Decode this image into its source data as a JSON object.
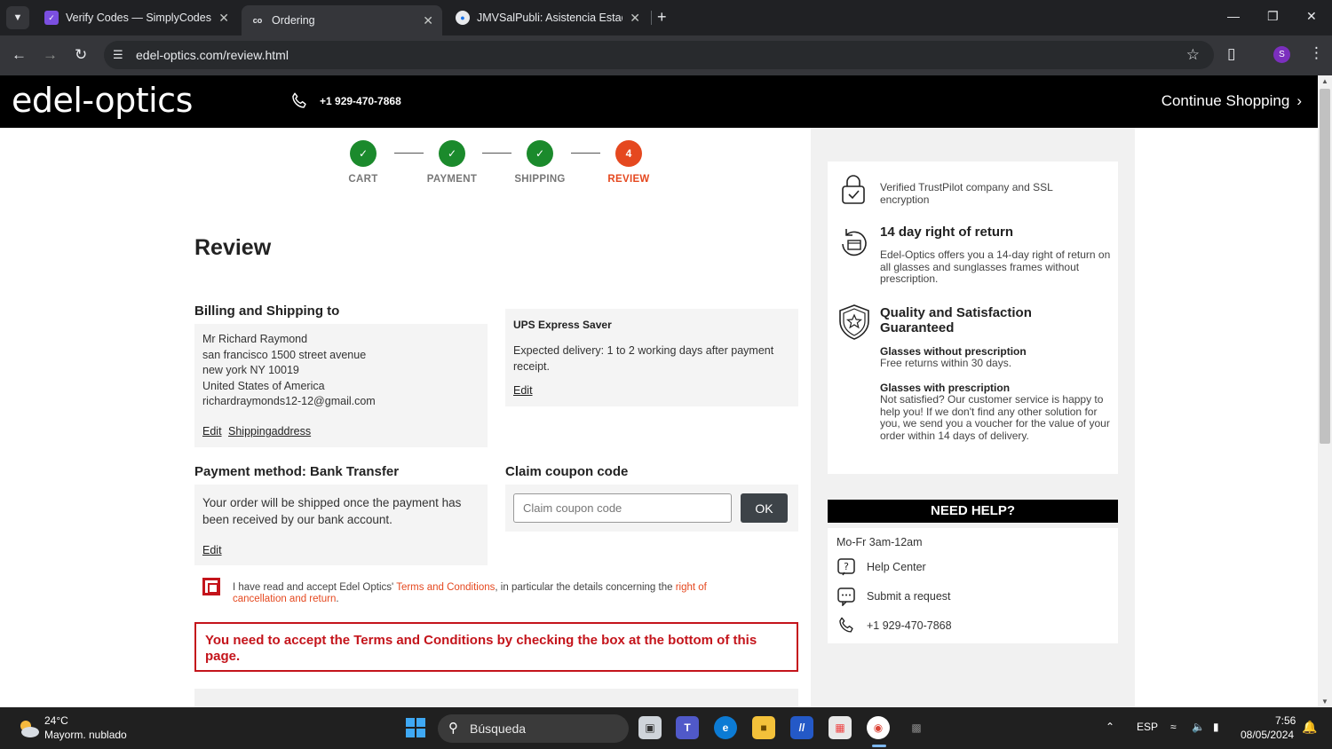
{
  "browser": {
    "tabs": [
      {
        "title": "Verify Codes — SimplyCodes",
        "favicon": "simplycodes-icon",
        "active": false
      },
      {
        "title": "Ordering",
        "favicon": "edel-optics-icon",
        "active": true
      },
      {
        "title": "JMVSalPubli: Asistencia Estadíst",
        "favicon": "globe-icon",
        "active": false
      }
    ],
    "url": "edel-optics.com/review.html",
    "profile_initial": "S",
    "accent_color": "#7b2fbe"
  },
  "site": {
    "logo": "edel-optics",
    "phone": "+1 929-470-7868",
    "continue_label": "Continue Shopping"
  },
  "steps": [
    {
      "label": "CART",
      "state": "done",
      "number": ""
    },
    {
      "label": "PAYMENT",
      "state": "done",
      "number": ""
    },
    {
      "label": "SHIPPING",
      "state": "done",
      "number": ""
    },
    {
      "label": "REVIEW",
      "state": "current",
      "number": "4"
    }
  ],
  "review": {
    "title": "Review",
    "billing": {
      "heading": "Billing and Shipping to",
      "lines": [
        "Mr Richard Raymond",
        "san francisco 1500 street avenue",
        "new york NY 10019",
        "United States of America",
        "richardraymonds12-12@gmail.com"
      ],
      "edit_label": "Edit",
      "shipping_address_label": "Shippingaddress"
    },
    "shipping": {
      "method": "UPS Express Saver",
      "description": "Expected delivery: 1 to 2 working days after payment receipt.",
      "edit_label": "Edit"
    },
    "payment": {
      "heading": "Payment method: Bank Transfer",
      "description": "Your order will be shipped once the payment has been received by our bank account.",
      "edit_label": "Edit"
    },
    "coupon": {
      "heading": "Claim coupon code",
      "placeholder": "Claim coupon code",
      "button_label": "OK"
    },
    "terms": {
      "prefix": "I have read and accept Edel Optics' ",
      "link1": "Terms and Conditions",
      "middle": ", in particular the details concerning the ",
      "link2": "right of cancellation and return",
      "suffix": ".",
      "checked": false
    },
    "error": "You need to accept the Terms and Conditions by checking the box at the bottom of this page."
  },
  "trust": {
    "ssl_text": "Verified TrustPilot company and SSL encryption",
    "return_heading": "14 day right of return",
    "return_text": "Edel-Optics offers you a 14-day right of return on all glasses and sunglasses frames without prescription.",
    "quality_heading": "Quality and Satisfaction Guaranteed",
    "no_rx_heading": "Glasses without prescription",
    "no_rx_text": "Free returns within 30 days.",
    "rx_heading": "Glasses with prescription",
    "rx_text": "Not satisfied? Our customer service is happy to help you! If we don't find any other solution for you, we send you a voucher for the value of your order within 14 days of delivery."
  },
  "help": {
    "heading": "NEED HELP?",
    "hours": "Mo-Fr 3am-12am",
    "items": [
      "Help Center",
      "Submit a request",
      "+1 929-470-7868"
    ]
  },
  "taskbar": {
    "weather_temp": "24°C",
    "weather_desc": "Mayorm. nublado",
    "search_placeholder": "Búsqueda",
    "language": "ESP",
    "time": "7:56",
    "date": "08/05/2024"
  }
}
